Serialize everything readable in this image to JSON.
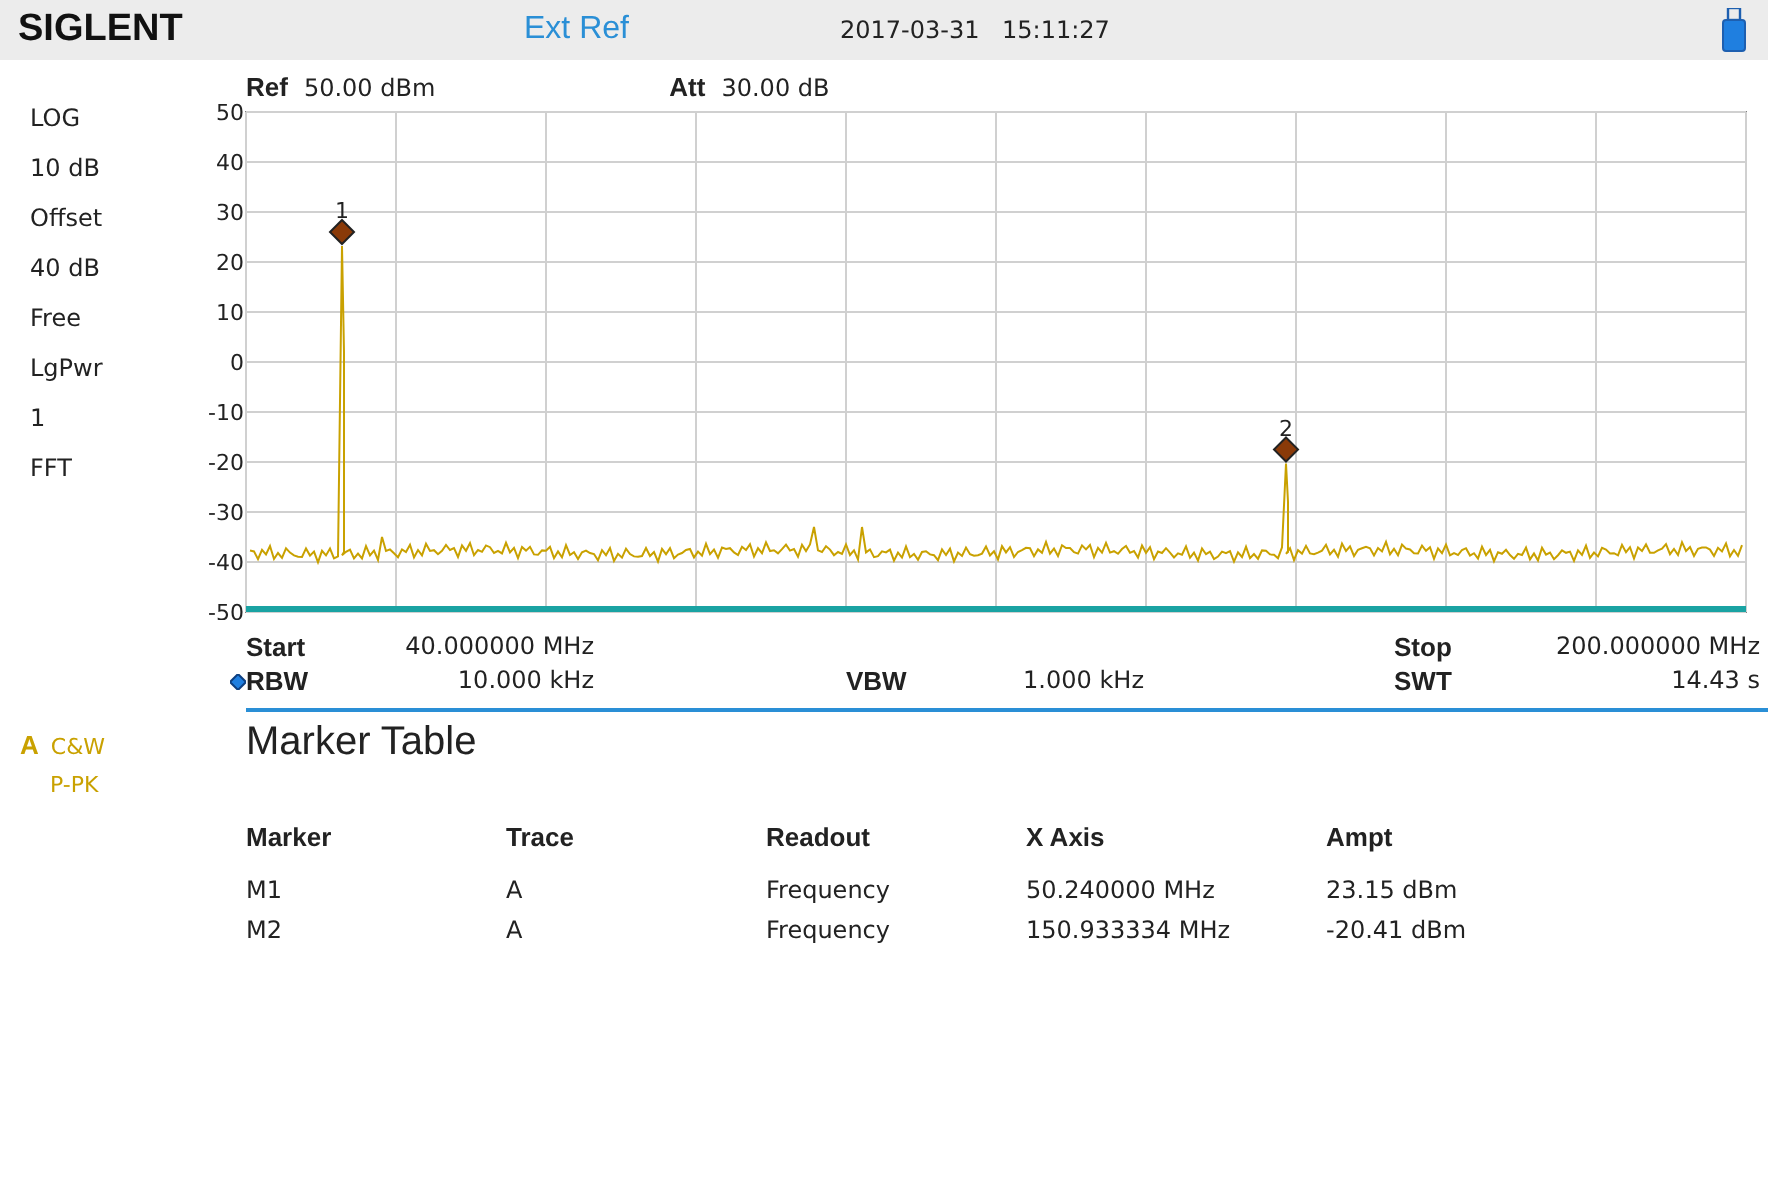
{
  "header": {
    "logo": "SIGLENT",
    "ref_source": "Ext Ref",
    "date": "2017-03-31",
    "time": "15:11:27"
  },
  "settings": [
    "LOG",
    "10 dB",
    "Offset",
    "40 dB",
    "Free",
    "LgPwr",
    "1",
    "FFT"
  ],
  "trace_info": {
    "trace": "A",
    "mode": "C&W",
    "detector": "P-PK"
  },
  "plot": {
    "ref_label": "Ref",
    "ref_value": "50.00 dBm",
    "att_label": "Att",
    "att_value": "30.00 dB",
    "y_ticks": [
      "50",
      "40",
      "30",
      "20",
      "10",
      "0",
      "-10",
      "-20",
      "-30",
      "-40",
      "-50"
    ],
    "markers": [
      {
        "label": "1"
      },
      {
        "label": "2"
      }
    ]
  },
  "params": [
    {
      "label": "Start",
      "value": "40.000000 MHz"
    },
    {
      "label": "Stop",
      "value": "200.000000 MHz"
    },
    {
      "label": "RBW",
      "value": "10.000 kHz"
    },
    {
      "label": "VBW",
      "value": "1.000 kHz"
    },
    {
      "label": "SWT",
      "value": "14.43 s"
    }
  ],
  "marker_table": {
    "title": "Marker Table",
    "columns": [
      "Marker",
      "Trace",
      "Readout",
      "X Axis",
      "Ampt"
    ],
    "rows": [
      [
        "M1",
        "A",
        "Frequency",
        "50.240000 MHz",
        "23.15 dBm"
      ],
      [
        "M2",
        "A",
        "Frequency",
        "150.933334 MHz",
        "-20.41 dBm"
      ]
    ]
  }
}
